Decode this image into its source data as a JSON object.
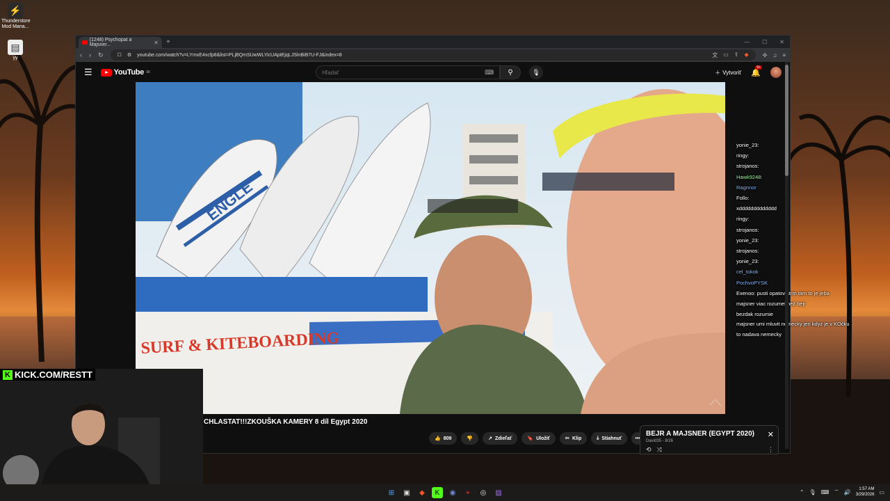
{
  "desktop": {
    "icons": [
      {
        "label": "Thunderstore Mod Mana...",
        "icon": "thunderstore-icon"
      },
      {
        "label": "yy",
        "icon": "file-icon"
      }
    ]
  },
  "browser": {
    "tab_title": "(1248) Psychopat a Majsner...",
    "url": "youtube.com/watch?v=LYmxE4xcfp8&list=PLjBQmSUwWLYicUAptEjqLJSlnBiB7U-FJ&index=8"
  },
  "youtube": {
    "logo_text": "YouTube",
    "logo_country": "SK",
    "search_placeholder": "Hľadať",
    "create_label": "Vytvoriť",
    "notifications_badge": "9+",
    "video_title": "CHLASTAT!!!ZKOUŠKA KAMERY 8 díl Egypt 2020",
    "actions": {
      "like_count": "809",
      "share": "Zdieľať",
      "save": "Uložiť",
      "clip": "Klip",
      "download": "Stiahnuť"
    },
    "playlist": {
      "title": "BEJR A MAJSNER (EGYPT 2020)",
      "subtitle": "David35 - 8/26"
    }
  },
  "video_scene": {
    "sign_text": "SURF & KITEBOARDING",
    "board_text": "ENGLE"
  },
  "chat": [
    {
      "user": "yonie_23:",
      "msg": "",
      "color": "#ffffff"
    },
    {
      "user": "ringy:",
      "msg": "",
      "color": "#ffffff"
    },
    {
      "user": "strojanos:",
      "msg": "",
      "color": "#ffffff"
    },
    {
      "user": "Hawk9248:",
      "msg": "",
      "color": "#9af59a"
    },
    {
      "user": "Ragnnor",
      "msg": "",
      "color": "#7fb4ff"
    },
    {
      "user": "Follo:",
      "msg": "",
      "color": "#ffffff"
    },
    {
      "user": "",
      "msg": "xddddddddddddd",
      "color": "#ff4a4a"
    },
    {
      "user": "ringy:",
      "msg": "",
      "color": "#ffffff"
    },
    {
      "user": "strojanos:",
      "msg": "",
      "color": "#ffffff"
    },
    {
      "user": "yonie_23:",
      "msg": "",
      "color": "#ffffff"
    },
    {
      "user": "strojanos:",
      "msg": "",
      "color": "#ffffff"
    },
    {
      "user": "yonie_23:",
      "msg": "",
      "color": "#ffffff"
    },
    {
      "user": "cel_tokok",
      "msg": "",
      "color": "#7fb4ff"
    },
    {
      "user": "PochvoPYSK",
      "msg": "",
      "color": "#7fb4ff"
    },
    {
      "user": "Exenoo:",
      "msg": "pusti opatov strm tam to je jeba",
      "color": "#ffffff"
    },
    {
      "user": "",
      "msg": "majsner viac rozumel než bejr",
      "color": "#ff4a4a"
    },
    {
      "user": "",
      "msg": "bezdak rozumie",
      "color": "#ff4a4a"
    },
    {
      "user": "",
      "msg": "majsner umi mluvit nemecky jen kdyz je v KOčku",
      "color": "#ff4a4a"
    },
    {
      "user": "",
      "msg": "to nadava nemecky",
      "color": "#ff4a4a"
    }
  ],
  "webcam": {
    "kick_label": "KICK.COM/RESTT"
  },
  "taskbar": {
    "time": "1:57 AM",
    "date": "3/29/2026"
  }
}
